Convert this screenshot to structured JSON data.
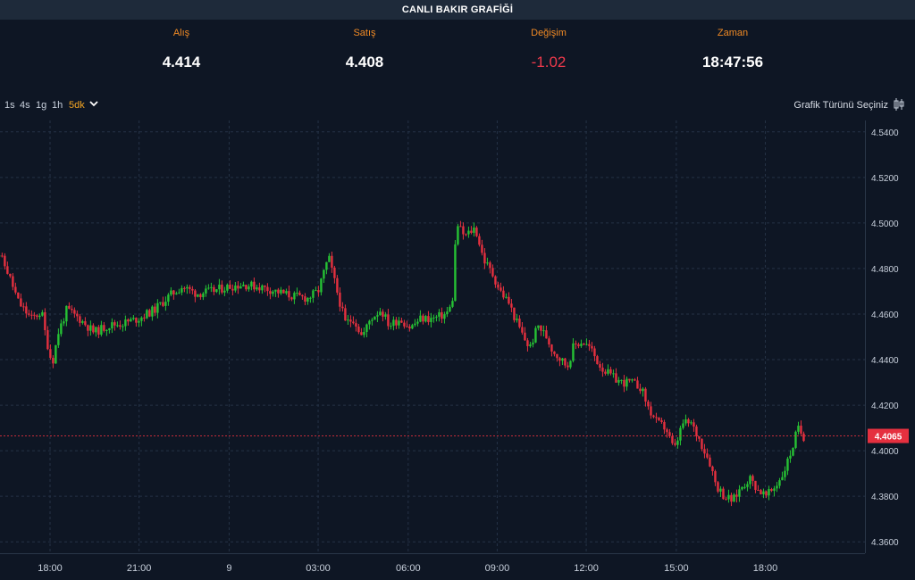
{
  "header": {
    "title": "CANLI BAKIR GRAFİĞİ"
  },
  "stats": {
    "bid": {
      "label": "Alış",
      "value": "4.414"
    },
    "ask": {
      "label": "Satış",
      "value": "4.408"
    },
    "change": {
      "label": "Değişim",
      "value": "-1.02"
    },
    "time": {
      "label": "Zaman",
      "value": "18:47:56"
    }
  },
  "toolbar": {
    "timeframes": [
      "1s",
      "4s",
      "1g",
      "1h",
      "5dk"
    ],
    "active_timeframe": "5dk",
    "chart_type_label": "Grafik Türünü Seçiniz",
    "chart_type_icon": "candlestick-icon",
    "dropdown_icon": "chevron-down-icon"
  },
  "colors": {
    "up": "#26c234",
    "down": "#e5303f",
    "last_price": "#e5303f",
    "accent": "#f08a24"
  },
  "chart_data": {
    "type": "candlestick",
    "title": "",
    "xlabel": "",
    "ylabel": "",
    "ylim": [
      4.355,
      4.545
    ],
    "y_ticks": [
      "4.3600",
      "4.3800",
      "4.4000",
      "4.4200",
      "4.4400",
      "4.4600",
      "4.4800",
      "4.5000",
      "4.5200",
      "4.5400"
    ],
    "x_ticks": [
      {
        "label": "18:00",
        "x": 0.56
      },
      {
        "label": "21:00",
        "x": 1.41
      },
      {
        "label": "9",
        "x": 2.27
      },
      {
        "label": "03:00",
        "x": 3.12
      },
      {
        "label": "06:00",
        "x": 3.98
      },
      {
        "label": "09:00",
        "x": 4.83
      },
      {
        "label": "12:00",
        "x": 5.68
      },
      {
        "label": "15:00",
        "x": 6.54
      },
      {
        "label": "18:00",
        "x": 7.39
      }
    ],
    "last_price": "4.4065",
    "grid": true,
    "price_path": [
      [
        0.0,
        4.48
      ],
      [
        0.06,
        4.488
      ],
      [
        0.16,
        4.478
      ],
      [
        0.26,
        4.465
      ],
      [
        0.38,
        4.458
      ],
      [
        0.48,
        4.461
      ],
      [
        0.52,
        4.45
      ],
      [
        0.58,
        4.438
      ],
      [
        0.64,
        4.452
      ],
      [
        0.72,
        4.462
      ],
      [
        0.84,
        4.458
      ],
      [
        0.98,
        4.452
      ],
      [
        1.12,
        4.455
      ],
      [
        1.26,
        4.456
      ],
      [
        1.4,
        4.458
      ],
      [
        1.56,
        4.462
      ],
      [
        1.7,
        4.468
      ],
      [
        1.82,
        4.472
      ],
      [
        1.96,
        4.469
      ],
      [
        2.1,
        4.47
      ],
      [
        2.26,
        4.472
      ],
      [
        2.4,
        4.473
      ],
      [
        2.56,
        4.472
      ],
      [
        2.72,
        4.47
      ],
      [
        2.86,
        4.468
      ],
      [
        3.02,
        4.467
      ],
      [
        3.12,
        4.47
      ],
      [
        3.22,
        4.485
      ],
      [
        3.3,
        4.47
      ],
      [
        3.38,
        4.456
      ],
      [
        3.46,
        4.458
      ],
      [
        3.54,
        4.45
      ],
      [
        3.62,
        4.458
      ],
      [
        3.72,
        4.462
      ],
      [
        3.8,
        4.455
      ],
      [
        3.9,
        4.458
      ],
      [
        4.0,
        4.454
      ],
      [
        4.1,
        4.458
      ],
      [
        4.22,
        4.458
      ],
      [
        4.34,
        4.46
      ],
      [
        4.4,
        4.464
      ],
      [
        4.44,
        4.5
      ],
      [
        4.52,
        4.494
      ],
      [
        4.62,
        4.498
      ],
      [
        4.7,
        4.484
      ],
      [
        4.78,
        4.478
      ],
      [
        4.86,
        4.47
      ],
      [
        4.94,
        4.465
      ],
      [
        5.0,
        4.458
      ],
      [
        5.08,
        4.45
      ],
      [
        5.14,
        4.445
      ],
      [
        5.22,
        4.455
      ],
      [
        5.3,
        4.45
      ],
      [
        5.36,
        4.444
      ],
      [
        5.44,
        4.44
      ],
      [
        5.5,
        4.437
      ],
      [
        5.56,
        4.446
      ],
      [
        5.64,
        4.448
      ],
      [
        5.72,
        4.445
      ],
      [
        5.8,
        4.438
      ],
      [
        5.86,
        4.435
      ],
      [
        5.94,
        4.432
      ],
      [
        6.02,
        4.43
      ],
      [
        6.1,
        4.43
      ],
      [
        6.2,
        4.428
      ],
      [
        6.28,
        4.418
      ],
      [
        6.36,
        4.412
      ],
      [
        6.44,
        4.41
      ],
      [
        6.52,
        4.4
      ],
      [
        6.6,
        4.412
      ],
      [
        6.68,
        4.412
      ],
      [
        6.76,
        4.405
      ],
      [
        6.86,
        4.395
      ],
      [
        6.92,
        4.385
      ],
      [
        7.0,
        4.38
      ],
      [
        7.08,
        4.378
      ],
      [
        7.16,
        4.384
      ],
      [
        7.24,
        4.388
      ],
      [
        7.32,
        4.383
      ],
      [
        7.4,
        4.38
      ],
      [
        7.48,
        4.384
      ],
      [
        7.56,
        4.39
      ],
      [
        7.64,
        4.4
      ],
      [
        7.7,
        4.41
      ],
      [
        7.76,
        4.406
      ]
    ]
  }
}
